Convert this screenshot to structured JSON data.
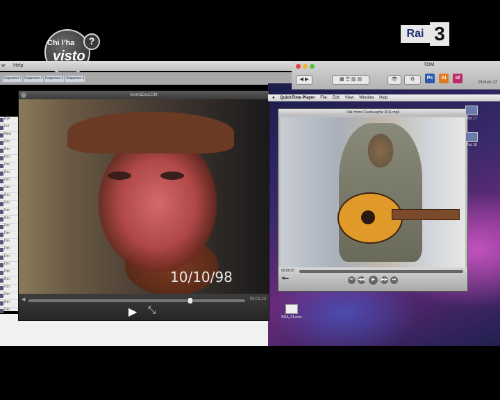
{
  "overlay": {
    "show_logo_line1": "Chi l'ha",
    "show_logo_line2": "visto",
    "show_logo_mark": "?",
    "channel_text": "Rai",
    "channel_number": "3"
  },
  "left_app": {
    "menu": [
      "w",
      "Help"
    ],
    "tabs": [
      "Sequence 1",
      "Sequence 2",
      "Sequence 3",
      "Sequence 4"
    ],
    "list_rows": [
      "Eye",
      "Fol",
      "New",
      "Dm",
      "Dm",
      "Dm",
      "Dm",
      "Dm",
      "Dm",
      "Dm",
      "Dm",
      "Dm",
      "Dm",
      "Dm",
      "Dm",
      "Dm",
      "Dm",
      "Dm",
      "Dm",
      "Dm",
      "Dm",
      "Dm",
      "Dm",
      "Dm",
      "Dm",
      "Dm",
      "Dm"
    ]
  },
  "movie_window": {
    "title": "Mom&Dad.DM",
    "datestamp": "10/10/98",
    "timecode": "00:01:23",
    "progress": 0.75,
    "play_icon": "play-icon",
    "fullscreen_icon": "fullscreen-icon"
  },
  "finder": {
    "title": "TOM",
    "traffic_colors": [
      "#e0443a",
      "#f0b030",
      "#58c040"
    ],
    "apps": [
      {
        "label": "Ps",
        "color": "#2a5aa8"
      },
      {
        "label": "Ai",
        "color": "#e07a20"
      },
      {
        "label": "Id",
        "color": "#c02a6a"
      }
    ],
    "picture_label": "Picture 17"
  },
  "quicktime": {
    "menu": [
      "QuickTime Player",
      "File",
      "Edit",
      "View",
      "Window",
      "Help"
    ],
    "window_title": "Ulla Homo Cuoria aprile 2011.mp4",
    "time": "00:00:07",
    "progress": 0.62
  },
  "desktop_icons": [
    {
      "label": "BDA_01.mov"
    }
  ],
  "side_icons": [
    {
      "label": "Pict 17"
    },
    {
      "label": "Pict 18"
    }
  ]
}
